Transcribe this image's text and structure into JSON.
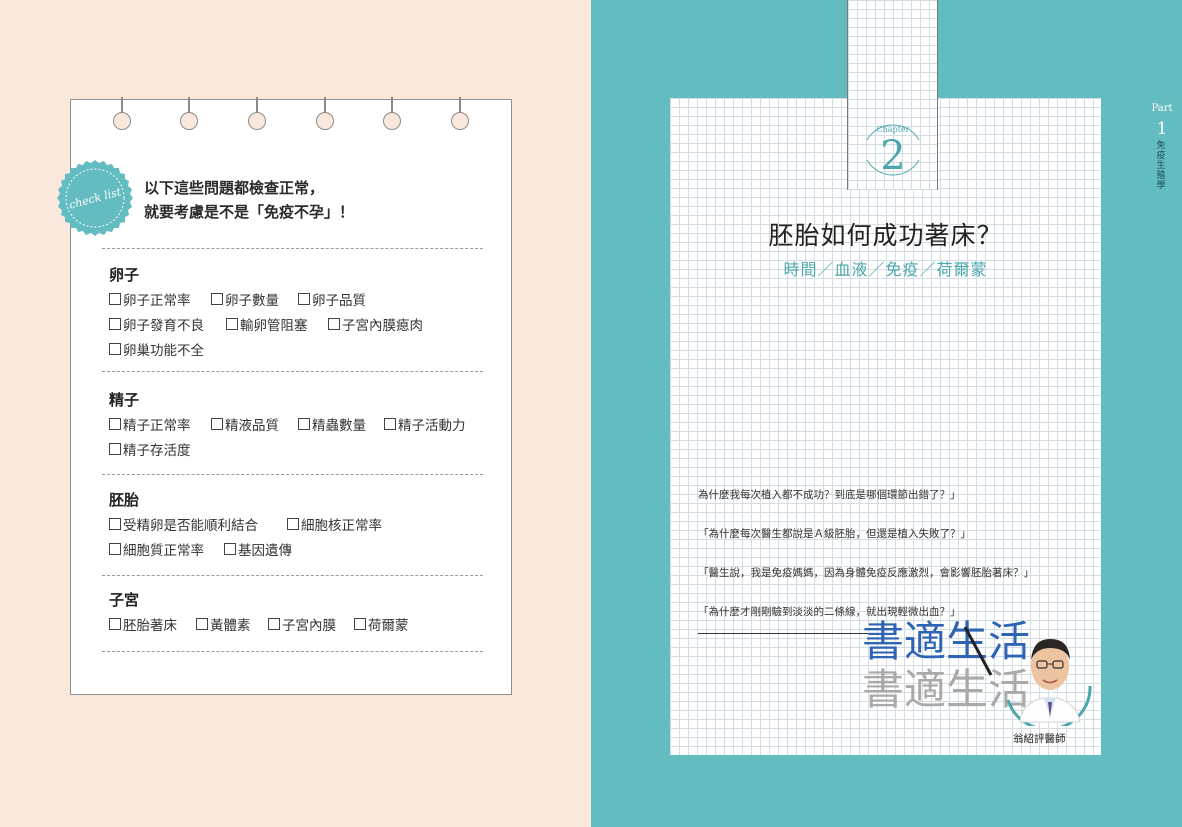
{
  "left": {
    "badge_text": "check list",
    "intro_line1": "以下這些問題都檢查正常，",
    "intro_line2": "就要考慮是不是「免疫不孕」！",
    "sections": [
      {
        "title": "卵子",
        "items": [
          "卵子正常率",
          "卵子數量",
          "卵子品質",
          "卵子發育不良",
          "輸卵管阻塞",
          "子宮內膜瘜肉",
          "卵巢功能不全"
        ]
      },
      {
        "title": "精子",
        "items": [
          "精子正常率",
          "精液品質",
          "精蟲數量",
          "精子活動力",
          "精子存活度"
        ]
      },
      {
        "title": "胚胎",
        "items": [
          "受精卵是否能順利結合",
          "細胞核正常率",
          "細胞質正常率",
          "基因遺傳"
        ]
      },
      {
        "title": "子宮",
        "items": [
          "胚胎著床",
          "黃體素",
          "子宮內膜",
          "荷爾蒙"
        ]
      }
    ]
  },
  "right": {
    "chapter_label": "Chapter",
    "chapter_number": "2",
    "title": "胚胎如何成功著床？",
    "subtitle": "時間／血液／免疫／荷爾蒙",
    "quotes": [
      "為什麼我每次植入都不成功？到底是哪個環節出錯了？」",
      "「為什麼每次醫生都說是Ａ級胚胎，但還是植入失敗了？」",
      "「醫生說，我是免疫媽媽，因為身體免疫反應激烈，會影響胚胎著床？」",
      "「為什麼才剛剛驗到淡淡的二條線，就出現輕微出血？」"
    ],
    "brand_text_1": "書適生活",
    "brand_text_2": "書適生活",
    "doctor_name": "翁紹評醫師",
    "part_label": "Part",
    "part_number": "1",
    "part_theme": "免疫生殖學"
  },
  "colors": {
    "left_background": "#fbe8dd",
    "right_background": "#63bcbf",
    "accent_teal": "#4ba7ab",
    "brand_blue": "#2f63b3"
  }
}
